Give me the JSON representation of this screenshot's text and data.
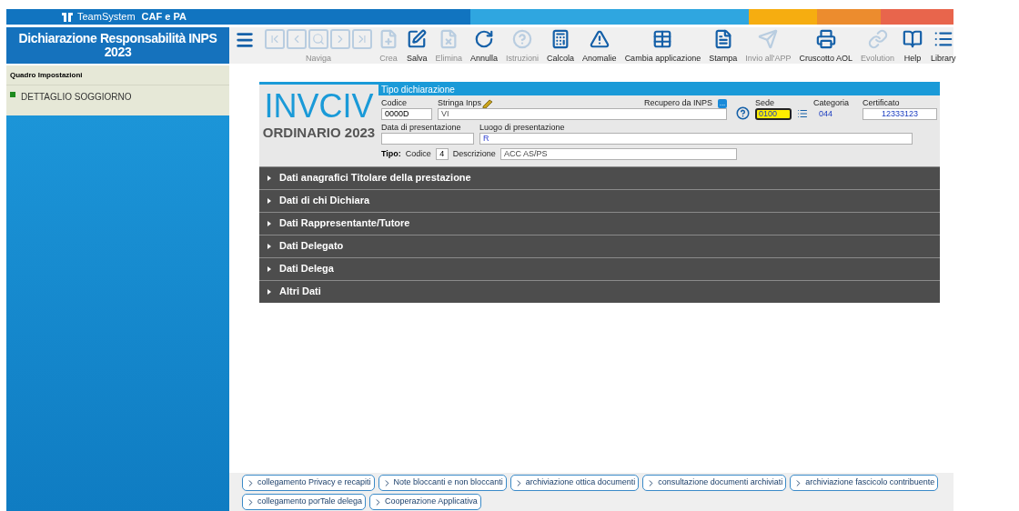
{
  "brand": {
    "company": "TeamSystem",
    "product": "CAF e PA"
  },
  "app_title": "Dichiarazione Responsabilità INPS 2023",
  "toolbar": [
    {
      "label": "Naviga",
      "disabled": true,
      "kind": "group"
    },
    {
      "label": "Crea",
      "disabled": true,
      "kind": "single"
    },
    {
      "label": "Salva",
      "disabled": false,
      "kind": "single"
    },
    {
      "label": "Elimina",
      "disabled": true,
      "kind": "single"
    },
    {
      "label": "Annulla",
      "disabled": false,
      "kind": "single"
    },
    {
      "label": "Istruzioni",
      "disabled": true,
      "kind": "single"
    },
    {
      "label": "Calcola",
      "disabled": false,
      "kind": "single"
    },
    {
      "label": "Anomalie",
      "disabled": false,
      "kind": "single"
    },
    {
      "label": "Cambia applicazione",
      "disabled": false,
      "kind": "single"
    },
    {
      "label": "Stampa",
      "disabled": false,
      "kind": "single"
    },
    {
      "label": "Invio all'APP",
      "disabled": true,
      "kind": "single"
    },
    {
      "label": "Cruscotto AOL",
      "disabled": false,
      "kind": "single"
    },
    {
      "label": "Evolution",
      "disabled": true,
      "kind": "single"
    },
    {
      "label": "Help",
      "disabled": false,
      "kind": "single"
    },
    {
      "label": "Library",
      "disabled": false,
      "kind": "single"
    }
  ],
  "sidebar": {
    "header": "Quadro Impostazioni",
    "items": [
      {
        "label": "DETTAGLIO SOGGIORNO",
        "color": "#1e8a1e"
      }
    ]
  },
  "form": {
    "logo": "INVCIV",
    "subtitle": "ORDINARIO 2023",
    "section_title": "Tipo dichiarazione",
    "codice": {
      "label": "Codice",
      "value": "0000D"
    },
    "stringa_inps": {
      "label": "Stringa Inps",
      "value": "VI"
    },
    "recupero": {
      "label": "Recupero da INPS",
      "button": "..."
    },
    "sede": {
      "label": "Sede",
      "value": "0100"
    },
    "categoria": {
      "label": "Categoria",
      "value": "044"
    },
    "certificato": {
      "label": "Certificato",
      "value": "12333123"
    },
    "data_presentazione": {
      "label": "Data di presentazione"
    },
    "luogo_presentazione": {
      "label": "Luogo di presentazione",
      "value": "R"
    },
    "tipo": {
      "label": "Tipo:",
      "codice_label": "Codice",
      "codice": "4",
      "descrizione_label": "Descrizione",
      "descrizione": "ACC AS/PS"
    }
  },
  "sections": [
    {
      "label": "Dati anagrafici Titolare della prestazione",
      "expanded": false
    },
    {
      "label": "Dati di chi Dichiara",
      "expanded": false
    },
    {
      "label": "Dati Rappresentante/Tutore",
      "expanded": false
    },
    {
      "label": "Dati Delegato",
      "expanded": false
    },
    {
      "label": "Dati Delega",
      "expanded": false
    },
    {
      "label": "Altri Dati",
      "expanded": false
    }
  ],
  "links": [
    "collegamento Privacy e recapiti",
    "Note bloccanti e non bloccanti",
    "archiviazione ottica documenti",
    "consultazione documenti archiviati",
    "archiviazione fascicolo contribuente",
    "collegamento porTale delega",
    "Cooperazione Applicativa"
  ]
}
